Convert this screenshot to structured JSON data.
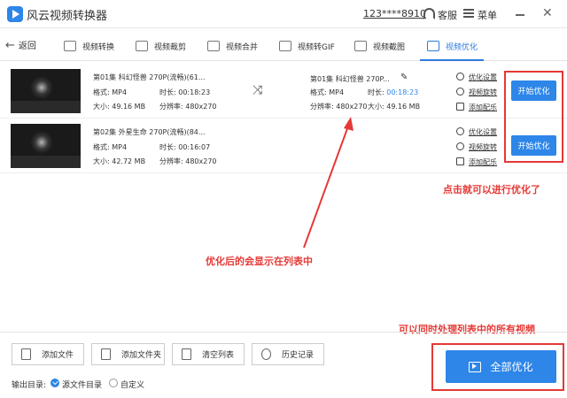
{
  "app": {
    "title": "风云视频转换器",
    "account": "123****8910",
    "support_label": "客服",
    "menu_label": "菜单",
    "close_glyph": "✕"
  },
  "nav": {
    "back_label": "返回",
    "tabs": [
      {
        "label": "视频转换",
        "icon": "video-convert-icon"
      },
      {
        "label": "视频裁剪",
        "icon": "video-crop-icon"
      },
      {
        "label": "视频合并",
        "icon": "video-merge-icon"
      },
      {
        "label": "视频转GIF",
        "icon": "gif-icon"
      },
      {
        "label": "视频截图",
        "icon": "screenshot-icon"
      },
      {
        "label": "视频优化",
        "icon": "optimize-icon",
        "active": true
      }
    ]
  },
  "files": [
    {
      "name": "第01集 科幻怪兽 270P(流畅)(61...",
      "format_label": "格式: MP4",
      "duration_label": "时长: 00:18:23",
      "size_label": "大小: 49.16 MB",
      "resolution_label": "分辨率: 480x270",
      "output": {
        "name": "第01集 科幻怪兽 270P...",
        "format_label": "格式: MP4",
        "duration_prefix": "时长: ",
        "duration_value": "00:18:23",
        "resolution_label": "分辨率: 480x270",
        "size_label": "大小: 49.16 MB"
      },
      "links": [
        "优化设置",
        "视频旋转",
        "添加配乐"
      ],
      "start_label": "开始优化"
    },
    {
      "name": "第02集 外星生命 270P(流畅)(84...",
      "format_label": "格式: MP4",
      "duration_label": "时长: 00:16:07",
      "size_label": "大小: 42.72 MB",
      "resolution_label": "分辨率: 480x270",
      "links": [
        "优化设置",
        "视频旋转",
        "添加配乐"
      ],
      "start_label": "开始优化"
    }
  ],
  "toolbar": {
    "add_file": "添加文件",
    "add_folder": "添加文件夹",
    "clear_list": "清空列表",
    "history": "历史记录"
  },
  "output_dir": {
    "label": "输出目录:",
    "option_source": "源文件目录",
    "option_custom": "自定义",
    "selected": "源文件目录"
  },
  "all_optimize_label": "全部优化",
  "annotations": {
    "click_hint": "点击就可以进行优化了",
    "result_hint": "优化后的会显示在列表中",
    "batch_hint": "可以同时处理列表中的所有视频"
  },
  "colors": {
    "accent": "#2d86e8",
    "annotation": "#e53935"
  }
}
